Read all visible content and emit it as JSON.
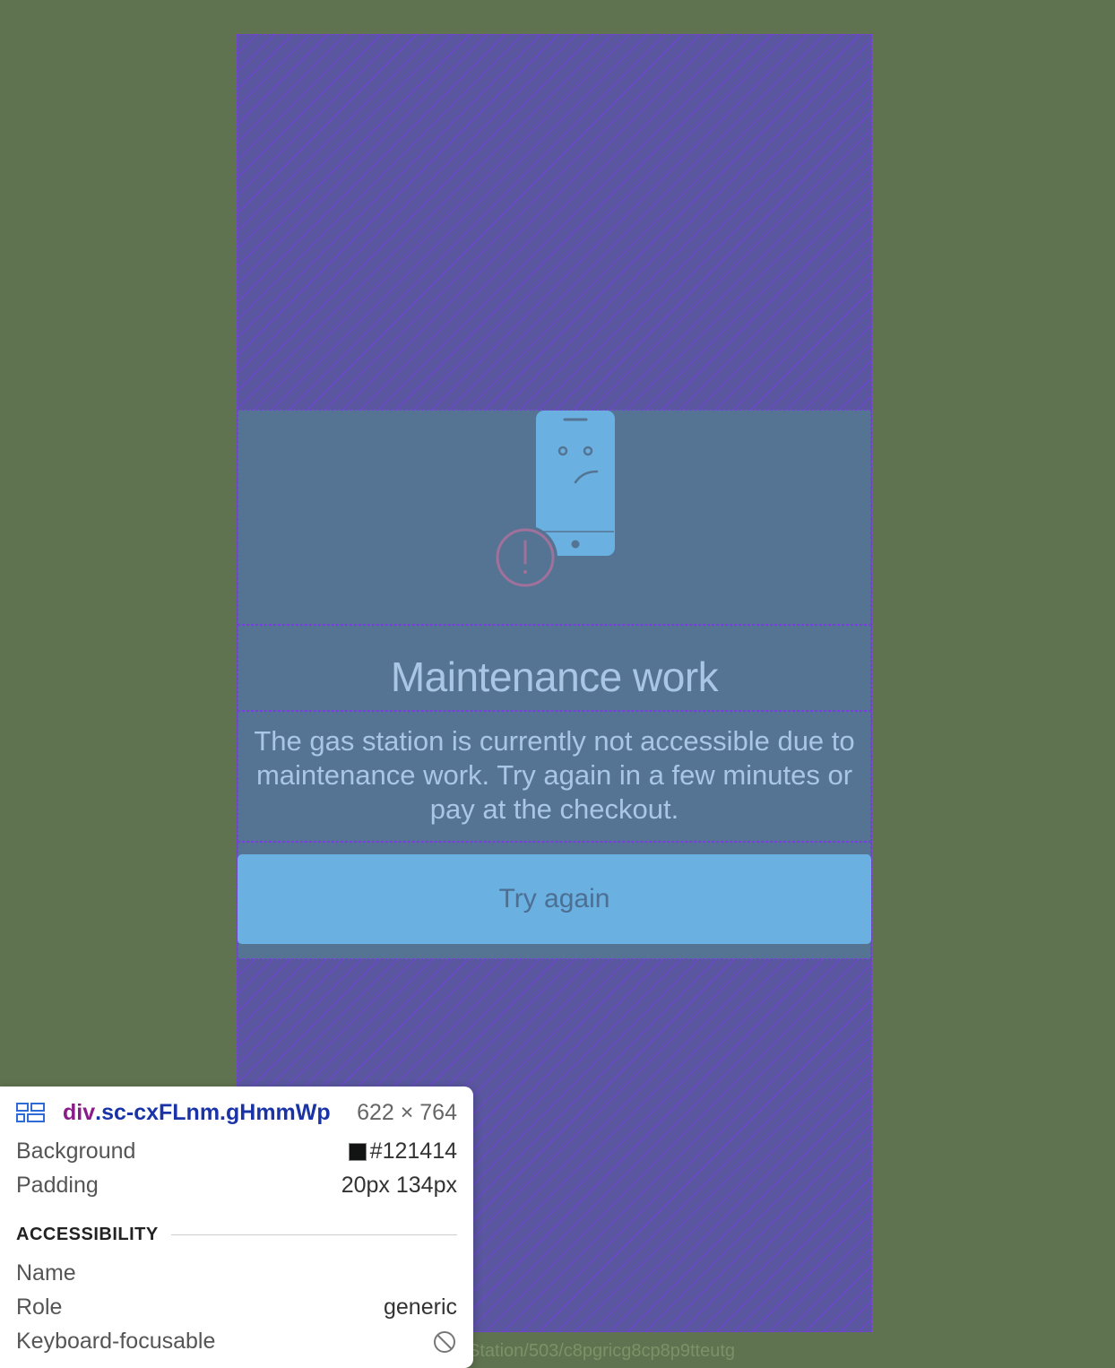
{
  "page": {
    "title": "Maintenance work",
    "description": "The gas station is currently not accessible due to maintenance work. Try again in a few minutes or pay at the checkout.",
    "retry_label": "Try again",
    "url_fragment": "Station/503/c8pgricg8cp8p9tteutg"
  },
  "illustration": {
    "icon": "sad-phone-icon",
    "badge_icon": "exclamation-circle-icon"
  },
  "inspector": {
    "element_tag": "div",
    "element_class": ".sc-cxFLnm.gHmmWp",
    "size": "622 × 764",
    "background_label": "Background",
    "background_value": "#121414",
    "padding_label": "Padding",
    "padding_value": "20px 134px",
    "accessibility_header": "ACCESSIBILITY",
    "name_label": "Name",
    "name_value": "",
    "role_label": "Role",
    "role_value": "generic",
    "keyboard_label": "Keyboard-focusable",
    "keyboard_icon": "not-allowed-icon"
  },
  "colors": {
    "page_background": "#5f7350",
    "overlay": "#5a57a0",
    "content_area": "#557493",
    "accent": "#6ab0e0",
    "text_light": "#a9c6e4",
    "warning": "#a0719a"
  }
}
